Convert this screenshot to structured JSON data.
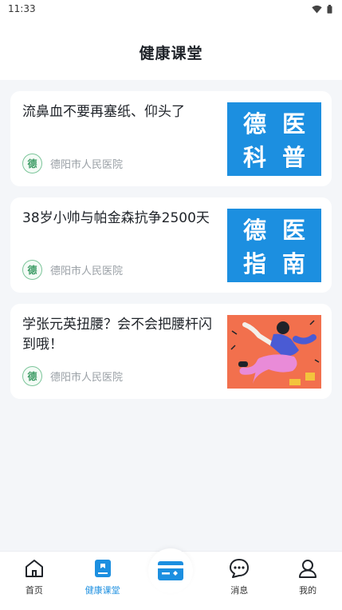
{
  "status_bar": {
    "time": "11:33",
    "icons": [
      "wifi-icon",
      "battery-icon"
    ]
  },
  "header": {
    "title": "健康课堂"
  },
  "articles": [
    {
      "title": "流鼻血不要再塞纸、仰头了",
      "source": "德阳市人民医院",
      "thumb_chars": [
        "德",
        "医",
        "科",
        "普"
      ]
    },
    {
      "title": "38岁小帅与帕金森抗争2500天",
      "source": "德阳市人民医院",
      "thumb_chars": [
        "德",
        "医",
        "指",
        "南"
      ]
    },
    {
      "title": "学张元英扭腰？会不会把腰杆闪到哦！",
      "source": "德阳市人民医院",
      "thumb_chars": []
    }
  ],
  "tabbar": {
    "home": "首页",
    "health": "健康课堂",
    "messages": "消息",
    "mine": "我的"
  },
  "colors": {
    "accent": "#1c8fe0",
    "background": "#f4f6f9"
  }
}
